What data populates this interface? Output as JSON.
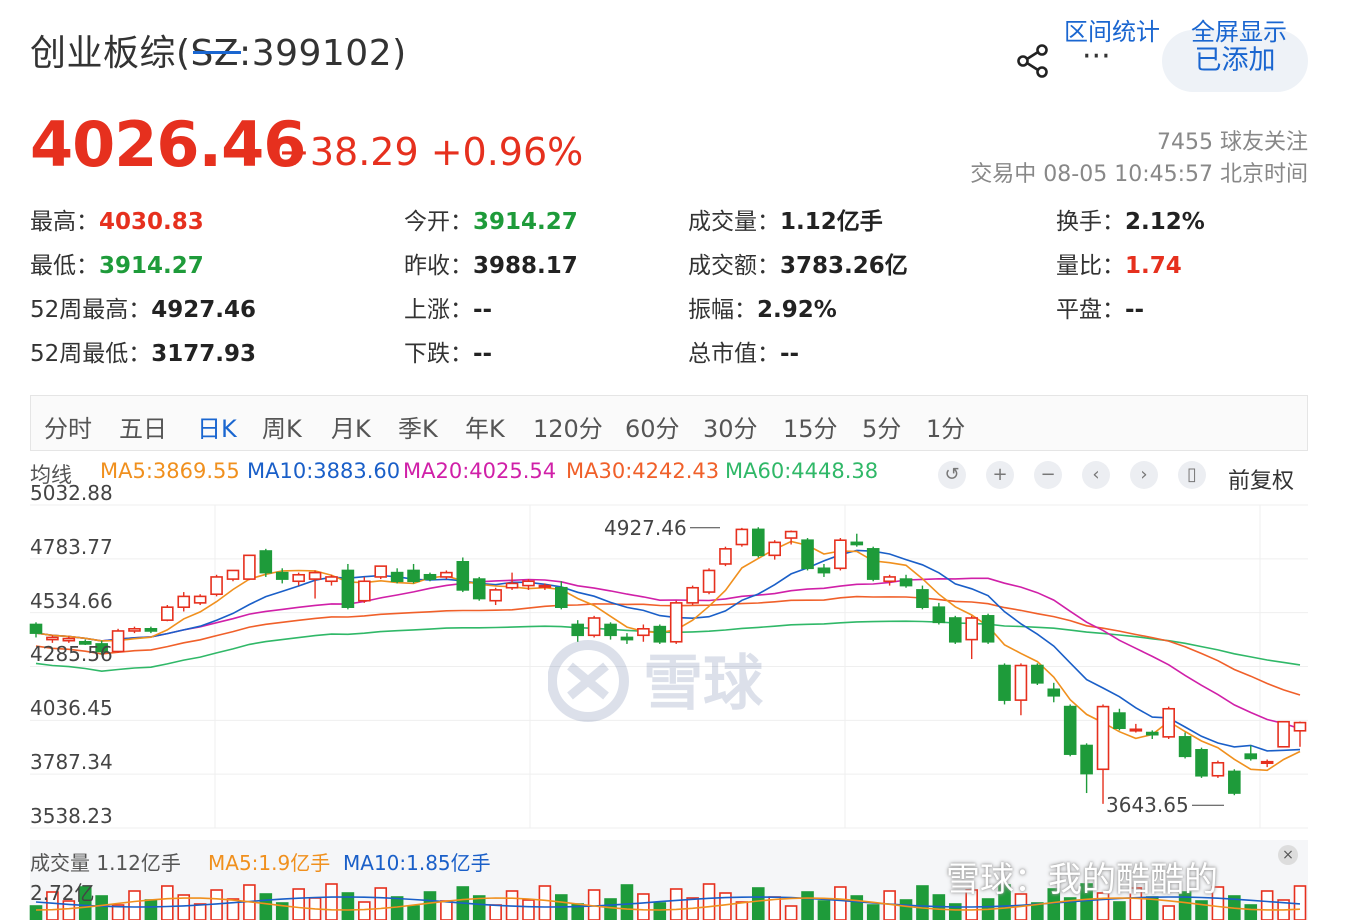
{
  "header": {
    "title": "创业板综(SZ:399102)",
    "added_label": "已添加",
    "more_label": "···"
  },
  "quote": {
    "price": "4026.46",
    "change": "+38.29 +0.96%",
    "followers": "7455 球友关注",
    "status": "交易中 08-05 10:45:57 北京时间"
  },
  "stats": [
    {
      "label": "最高：",
      "value": "4030.83",
      "tone": "red"
    },
    {
      "label": "今开：",
      "value": "3914.27",
      "tone": "green"
    },
    {
      "label": "成交量：",
      "value": "1.12亿手",
      "tone": ""
    },
    {
      "label": "换手：",
      "value": "2.12%",
      "tone": ""
    },
    {
      "label": "最低：",
      "value": "3914.27",
      "tone": "green"
    },
    {
      "label": "昨收：",
      "value": "3988.17",
      "tone": ""
    },
    {
      "label": "成交额：",
      "value": "3783.26亿",
      "tone": ""
    },
    {
      "label": "量比：",
      "value": "1.74",
      "tone": "red"
    },
    {
      "label": "52周最高：",
      "value": "4927.46",
      "tone": ""
    },
    {
      "label": "上涨：",
      "value": "--",
      "tone": ""
    },
    {
      "label": "振幅：",
      "value": "2.92%",
      "tone": ""
    },
    {
      "label": "平盘：",
      "value": "--",
      "tone": ""
    },
    {
      "label": "52周最低：",
      "value": "3177.93",
      "tone": ""
    },
    {
      "label": "下跌：",
      "value": "--",
      "tone": ""
    },
    {
      "label": "总市值：",
      "value": "--",
      "tone": ""
    }
  ],
  "tabs": [
    "分时",
    "五日",
    "日K",
    "周K",
    "月K",
    "季K",
    "年K",
    "120分",
    "60分",
    "30分",
    "15分",
    "5分",
    "1分"
  ],
  "active_tab": "日K",
  "tab_links": [
    "区间统计",
    "全屏显示"
  ],
  "ma_legend": {
    "label": "均线",
    "ma5": "MA5:3869.55",
    "ma10": "MA10:3883.60",
    "ma20": "MA20:4025.54",
    "ma30": "MA30:4242.43",
    "ma60": "MA60:4448.38"
  },
  "fuquan_label": "前复权",
  "controls": [
    "undo-icon",
    "zoom-in-icon",
    "zoom-out-icon",
    "prev-icon",
    "next-icon",
    "candle-icon"
  ],
  "volume_legend": {
    "label": "成交量 1.12亿手",
    "ma5": "MA5:1.9亿手",
    "ma10": "MA10:1.85亿手",
    "max_label": "2.72亿"
  },
  "watermark": {
    "main": "雪球",
    "corner": "雪球：我的酷酷的"
  },
  "colors": {
    "up": "#e6301e",
    "down": "#1e9b3a",
    "ma5": "#f0901e",
    "ma10": "#1a5fc8",
    "ma20": "#d020a8",
    "ma30": "#f0602a",
    "ma60": "#30b868",
    "accent": "#1a66d0"
  },
  "chart_data": {
    "type": "candlestick",
    "y_ticks": [
      "5032.88",
      "4783.77",
      "4534.66",
      "4285.56",
      "4036.45",
      "3787.34",
      "3538.23"
    ],
    "ylim": [
      3538.23,
      5032.88
    ],
    "annotations": [
      {
        "label": "4927.46",
        "value": 4927.46
      },
      {
        "label": "3643.65",
        "value": 3643.65
      }
    ],
    "candles": [
      {
        "o": 4480,
        "c": 4440,
        "h": 4490,
        "l": 4420
      },
      {
        "o": 4410,
        "c": 4420,
        "h": 4430,
        "l": 4395
      },
      {
        "o": 4405,
        "c": 4415,
        "h": 4425,
        "l": 4395
      },
      {
        "o": 4400,
        "c": 4390,
        "h": 4410,
        "l": 4385
      },
      {
        "o": 4390,
        "c": 4355,
        "h": 4405,
        "l": 4340
      },
      {
        "o": 4355,
        "c": 4450,
        "h": 4460,
        "l": 4350
      },
      {
        "o": 4450,
        "c": 4460,
        "h": 4470,
        "l": 4440
      },
      {
        "o": 4460,
        "c": 4450,
        "h": 4470,
        "l": 4440
      },
      {
        "o": 4500,
        "c": 4560,
        "h": 4570,
        "l": 4495
      },
      {
        "o": 4560,
        "c": 4610,
        "h": 4630,
        "l": 4540
      },
      {
        "o": 4580,
        "c": 4610,
        "h": 4620,
        "l": 4570
      },
      {
        "o": 4620,
        "c": 4700,
        "h": 4710,
        "l": 4610
      },
      {
        "o": 4690,
        "c": 4730,
        "h": 4730,
        "l": 4680
      },
      {
        "o": 4690,
        "c": 4800,
        "h": 4800,
        "l": 4685
      },
      {
        "o": 4820,
        "c": 4720,
        "h": 4830,
        "l": 4700
      },
      {
        "o": 4720,
        "c": 4690,
        "h": 4740,
        "l": 4670
      },
      {
        "o": 4680,
        "c": 4710,
        "h": 4720,
        "l": 4660
      },
      {
        "o": 4690,
        "c": 4720,
        "h": 4730,
        "l": 4600
      },
      {
        "o": 4680,
        "c": 4700,
        "h": 4710,
        "l": 4660
      },
      {
        "o": 4730,
        "c": 4560,
        "h": 4760,
        "l": 4550
      },
      {
        "o": 4590,
        "c": 4680,
        "h": 4700,
        "l": 4580
      },
      {
        "o": 4700,
        "c": 4750,
        "h": 4750,
        "l": 4690
      },
      {
        "o": 4720,
        "c": 4680,
        "h": 4740,
        "l": 4670
      },
      {
        "o": 4730,
        "c": 4680,
        "h": 4760,
        "l": 4670
      },
      {
        "o": 4710,
        "c": 4690,
        "h": 4720,
        "l": 4680
      },
      {
        "o": 4700,
        "c": 4720,
        "h": 4730,
        "l": 4690
      },
      {
        "o": 4770,
        "c": 4640,
        "h": 4790,
        "l": 4630
      },
      {
        "o": 4690,
        "c": 4600,
        "h": 4700,
        "l": 4590
      },
      {
        "o": 4590,
        "c": 4640,
        "h": 4650,
        "l": 4570
      },
      {
        "o": 4650,
        "c": 4670,
        "h": 4720,
        "l": 4640
      },
      {
        "o": 4660,
        "c": 4680,
        "h": 4690,
        "l": 4640
      },
      {
        "o": 4660,
        "c": 4660,
        "h": 4670,
        "l": 4640
      },
      {
        "o": 4650,
        "c": 4560,
        "h": 4680,
        "l": 4550
      },
      {
        "o": 4480,
        "c": 4430,
        "h": 4500,
        "l": 4400
      },
      {
        "o": 4430,
        "c": 4510,
        "h": 4520,
        "l": 4420
      },
      {
        "o": 4480,
        "c": 4430,
        "h": 4490,
        "l": 4410
      },
      {
        "o": 4420,
        "c": 4410,
        "h": 4440,
        "l": 4390
      },
      {
        "o": 4430,
        "c": 4460,
        "h": 4480,
        "l": 4400
      },
      {
        "o": 4470,
        "c": 4400,
        "h": 4480,
        "l": 4390
      },
      {
        "o": 4400,
        "c": 4580,
        "h": 4590,
        "l": 4390
      },
      {
        "o": 4580,
        "c": 4650,
        "h": 4660,
        "l": 4570
      },
      {
        "o": 4630,
        "c": 4730,
        "h": 4740,
        "l": 4620
      },
      {
        "o": 4760,
        "c": 4830,
        "h": 4840,
        "l": 4750
      },
      {
        "o": 4850,
        "c": 4920,
        "h": 4927,
        "l": 4840
      },
      {
        "o": 4920,
        "c": 4800,
        "h": 4930,
        "l": 4790
      },
      {
        "o": 4800,
        "c": 4860,
        "h": 4870,
        "l": 4780
      },
      {
        "o": 4880,
        "c": 4910,
        "h": 4915,
        "l": 4850
      },
      {
        "o": 4870,
        "c": 4740,
        "h": 4880,
        "l": 4730
      },
      {
        "o": 4740,
        "c": 4720,
        "h": 4760,
        "l": 4700
      },
      {
        "o": 4740,
        "c": 4870,
        "h": 4880,
        "l": 4730
      },
      {
        "o": 4860,
        "c": 4850,
        "h": 4900,
        "l": 4840
      },
      {
        "o": 4830,
        "c": 4690,
        "h": 4840,
        "l": 4680
      },
      {
        "o": 4680,
        "c": 4700,
        "h": 4710,
        "l": 4660
      },
      {
        "o": 4690,
        "c": 4660,
        "h": 4710,
        "l": 4650
      },
      {
        "o": 4640,
        "c": 4560,
        "h": 4660,
        "l": 4550
      },
      {
        "o": 4560,
        "c": 4490,
        "h": 4580,
        "l": 4480
      },
      {
        "o": 4510,
        "c": 4400,
        "h": 4520,
        "l": 4390
      },
      {
        "o": 4410,
        "c": 4510,
        "h": 4520,
        "l": 4320
      },
      {
        "o": 4520,
        "c": 4400,
        "h": 4530,
        "l": 4390
      },
      {
        "o": 4290,
        "c": 4130,
        "h": 4300,
        "l": 4110
      },
      {
        "o": 4130,
        "c": 4290,
        "h": 4300,
        "l": 4060
      },
      {
        "o": 4290,
        "c": 4210,
        "h": 4300,
        "l": 4200
      },
      {
        "o": 4180,
        "c": 4150,
        "h": 4210,
        "l": 4120
      },
      {
        "o": 4100,
        "c": 3880,
        "h": 4110,
        "l": 3870
      },
      {
        "o": 3920,
        "c": 3790,
        "h": 3930,
        "l": 3700
      },
      {
        "o": 3810,
        "c": 4100,
        "h": 4110,
        "l": 3650
      },
      {
        "o": 4070,
        "c": 4000,
        "h": 4090,
        "l": 3990
      },
      {
        "o": 3990,
        "c": 3995,
        "h": 4020,
        "l": 3980
      },
      {
        "o": 3980,
        "c": 3970,
        "h": 3990,
        "l": 3950
      },
      {
        "o": 3960,
        "c": 4090,
        "h": 4100,
        "l": 3950
      },
      {
        "o": 3960,
        "c": 3870,
        "h": 3980,
        "l": 3860
      },
      {
        "o": 3900,
        "c": 3780,
        "h": 3910,
        "l": 3770
      },
      {
        "o": 3780,
        "c": 3840,
        "h": 3850,
        "l": 3770
      },
      {
        "o": 3800,
        "c": 3700,
        "h": 3810,
        "l": 3690
      },
      {
        "o": 3880,
        "c": 3860,
        "h": 3920,
        "l": 3850
      },
      {
        "o": 3840,
        "c": 3845,
        "h": 3855,
        "l": 3820
      },
      {
        "o": 3914,
        "c": 4030,
        "h": 4031,
        "l": 3914
      },
      {
        "o": 3988,
        "c": 4026,
        "h": 4031,
        "l": 3914
      }
    ]
  }
}
